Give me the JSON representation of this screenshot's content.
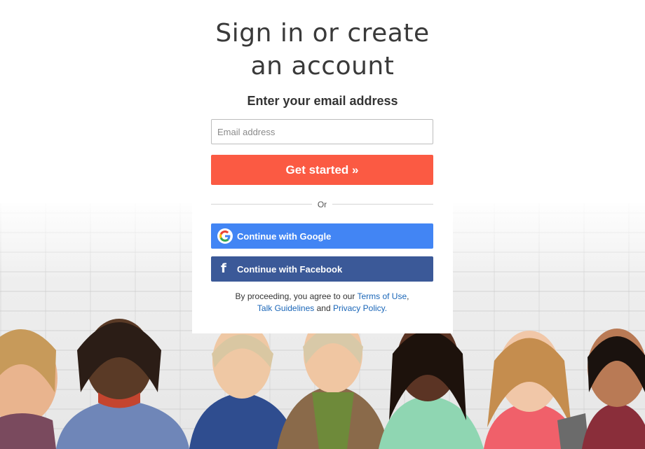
{
  "header": {
    "title_line1": "Sign in or create",
    "title_line2": "an account",
    "subtitle": "Enter your email address"
  },
  "form": {
    "email_placeholder": "Email address",
    "email_value": "",
    "submit_label": "Get started »"
  },
  "divider": {
    "text": "Or"
  },
  "social": {
    "google_label": "Continue with Google",
    "facebook_label": "Continue with Facebook",
    "google_icon": "google-g-icon",
    "facebook_icon": "facebook-f-icon"
  },
  "legal": {
    "prefix": "By proceeding, you agree to our ",
    "terms": "Terms of Use",
    "comma": ",",
    "guidelines": "Talk Guidelines",
    "and": " and ",
    "privacy": "Privacy Policy",
    "period": "."
  },
  "colors": {
    "accent": "#fb5a43",
    "google": "#4285f4",
    "facebook": "#3b5998",
    "link": "#1a66b8"
  }
}
